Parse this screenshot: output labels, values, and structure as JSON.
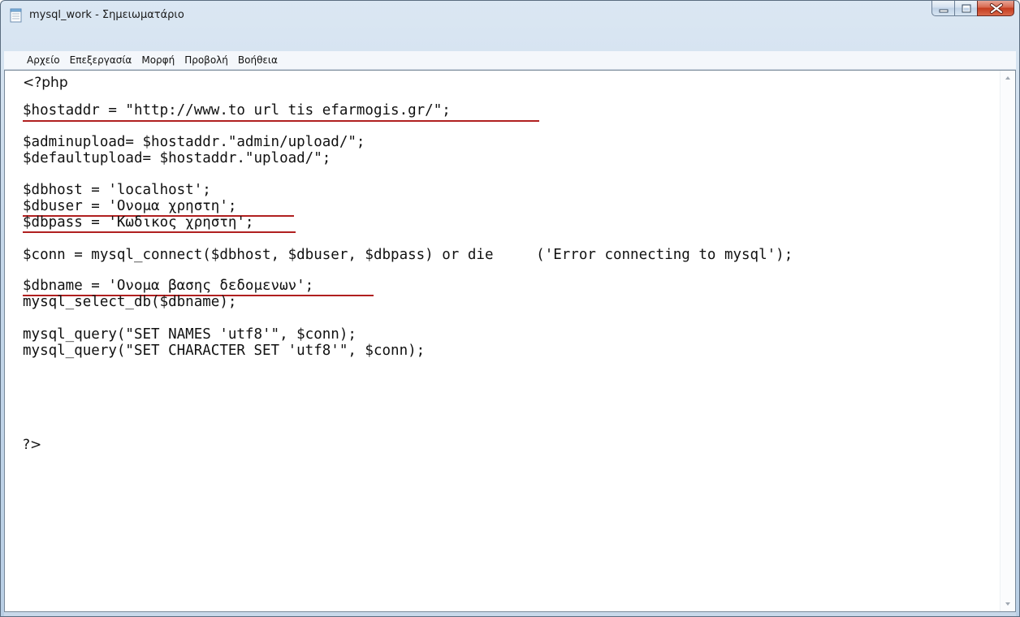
{
  "window": {
    "title": "mysql_work - Σημειωματάριο"
  },
  "menu": {
    "items": [
      "Αρχείο",
      "Επεξεργασία",
      "Μορφή",
      "Προβολή",
      "Βοήθεια"
    ]
  },
  "editor": {
    "lines": {
      "php_open": "<?php",
      "hostaddr": "$hostaddr = \"http://www.to url tis efarmogis.gr/\";",
      "adminupload": "$adminupload= $hostaddr.\"admin/upload/\";",
      "defaultupload": "$defaultupload= $hostaddr.\"upload/\";",
      "dbhost": "$dbhost = 'localhost';",
      "dbuser": "$dbuser = 'Ονομα χρηστη';",
      "dbpass": "$dbpass = 'Κωδικος χρηστη';",
      "conn": "$conn = mysql_connect($dbhost, $dbuser, $dbpass) or die     ('Error connecting to mysql');",
      "dbname": "$dbname = 'Ονομα βασης δεδομενων';",
      "select_db": "mysql_select_db($dbname);",
      "names": "mysql_query(\"SET NAMES 'utf8'\", $conn);",
      "charset": "mysql_query(\"SET CHARACTER SET 'utf8'\", $conn);",
      "php_close": "?>"
    }
  },
  "colors": {
    "underline": "#b02020",
    "close_button": "#c43b1e"
  },
  "icons": {
    "app": "notepad-icon",
    "minimize": "minimize-icon",
    "maximize": "maximize-icon",
    "close": "close-icon",
    "scroll_up": "scroll-up-arrow-icon",
    "scroll_down": "scroll-down-arrow-icon"
  }
}
